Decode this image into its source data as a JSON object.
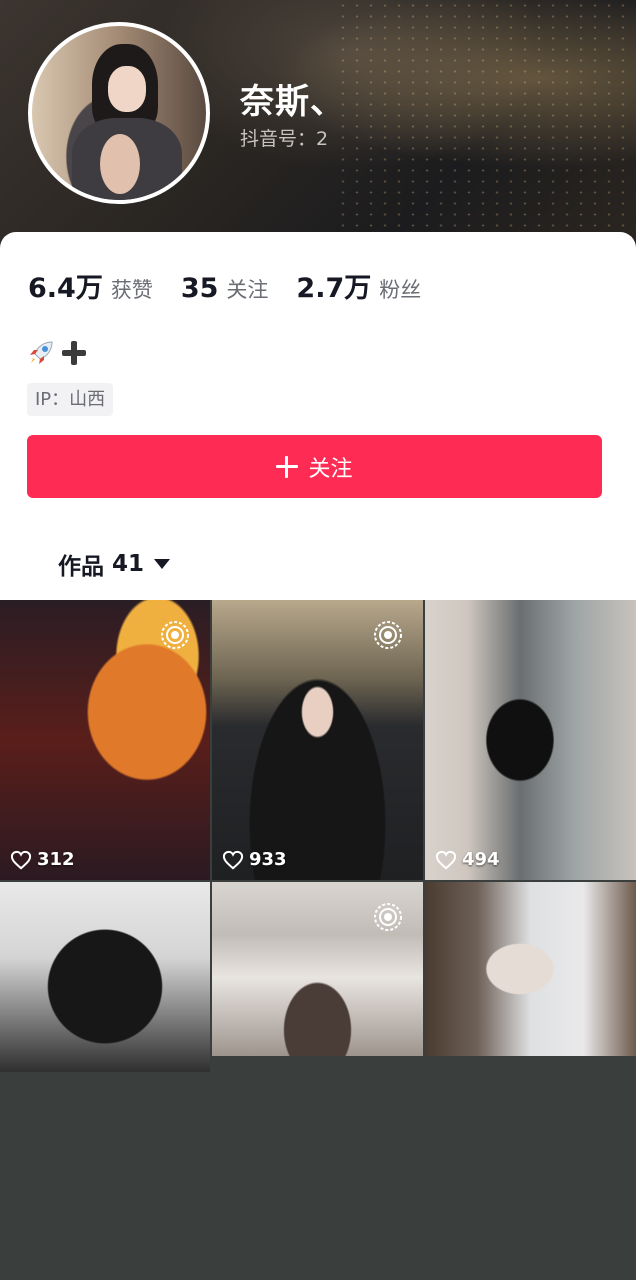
{
  "profile": {
    "nickname": "奈斯、",
    "douyin_id": "抖音号：2",
    "stats": [
      {
        "value": "6.4万",
        "label": "获赞"
      },
      {
        "value": "35",
        "label": "关注"
      },
      {
        "value": "2.7万",
        "label": "粉丝"
      }
    ],
    "bio_icons": [
      "rocket-icon",
      "plus-icon"
    ],
    "ip": "IP：山西"
  },
  "actions": {
    "follow_label": "关注"
  },
  "tabs": {
    "works_label": "作品",
    "works_count": "41"
  },
  "videos": [
    {
      "likes": "312",
      "live_photo": true
    },
    {
      "likes": "933",
      "live_photo": true
    },
    {
      "likes": "494",
      "live_photo": false
    },
    {
      "likes": "",
      "live_photo": false
    },
    {
      "likes": "",
      "live_photo": true
    },
    {
      "likes": "",
      "live_photo": false
    }
  ],
  "colors": {
    "follow_button": "#fe2c55",
    "text_primary": "#161823",
    "text_secondary": "#6b6d75",
    "bottom_background": "#3a3e3d"
  }
}
